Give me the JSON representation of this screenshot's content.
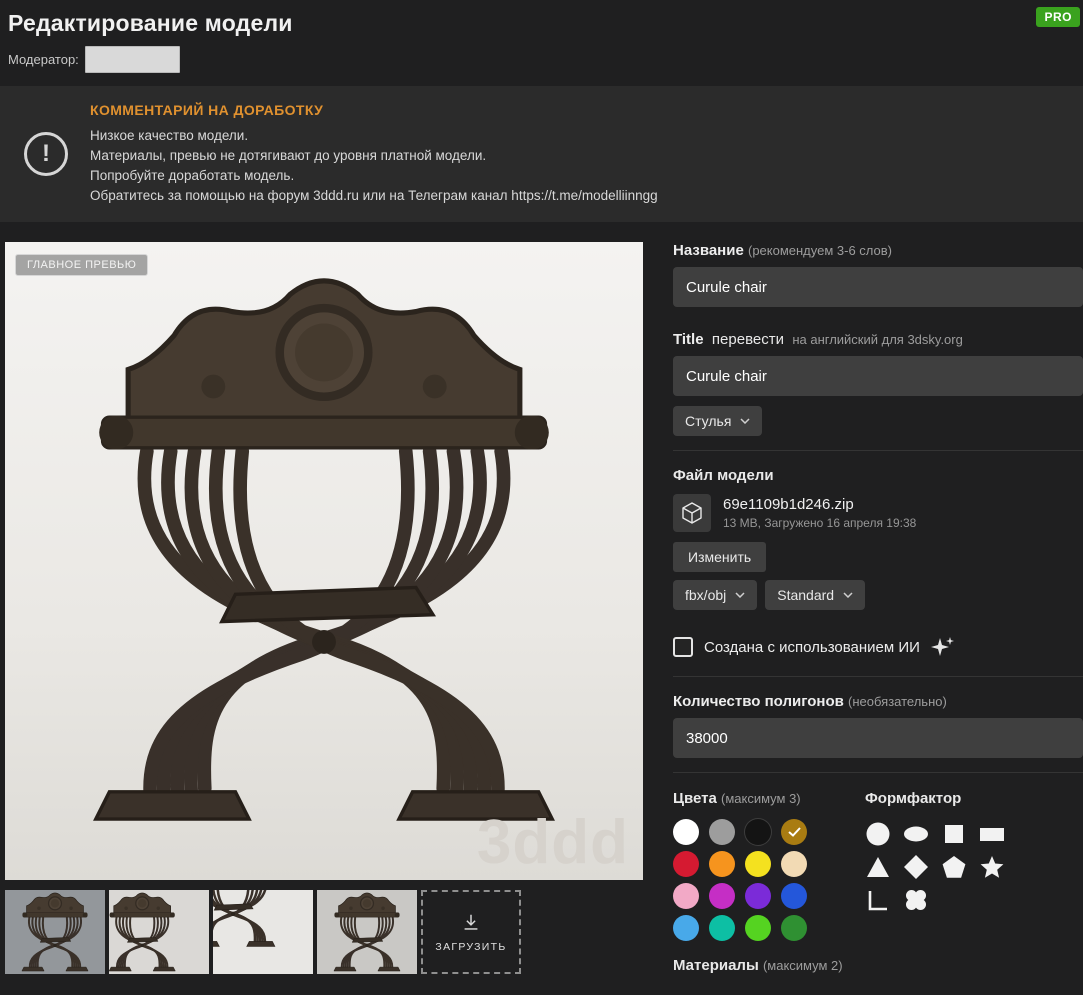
{
  "theme": {
    "pro_green": "#3aa21e",
    "accent_orange": "#e0912f",
    "panel_bg": "#2b2b2b",
    "input_bg": "#3f3f3f"
  },
  "header": {
    "title": "Редактирование модели",
    "pro_badge": "PRO",
    "moderator_label": "Модератор:",
    "moderator_value": ""
  },
  "warning": {
    "heading": "КОММЕНТАРИЙ НА ДОРАБОТКУ",
    "lines": [
      "Низкое качество модели.",
      "Материалы, превью не дотягивают до уровня платной модели.",
      "Попробуйте доработать модель.",
      "Обратитесь за помощью на форум 3ddd.ru или на Телеграм канал https://t.me/modelliinngg"
    ]
  },
  "preview": {
    "main_badge": "ГЛАВНОЕ ПРЕВЬЮ",
    "watermark": "3ddd",
    "upload_button": "ЗАГРУЗИТЬ"
  },
  "fields": {
    "name_label": "Название",
    "name_hint": "(рекомендуем 3-6 слов)",
    "name_value": "Curule chair",
    "title_label": "Title",
    "title_translate_link": "перевести",
    "title_hint": "на английский для 3dsky.org",
    "title_value": "Curule chair",
    "category_value": "Стулья",
    "polygons_label": "Количество полигонов",
    "polygons_hint": "(необязательно)",
    "polygons_value": "38000"
  },
  "file": {
    "section_title": "Файл модели",
    "filename": "69e1109b1d246.zip",
    "meta": "13 МВ, Загружено 16 апреля 19:38",
    "change_button": "Изменить",
    "format_value": "fbx/obj",
    "renderer_value": "Standard"
  },
  "ai": {
    "label": "Создана с использованием ИИ"
  },
  "colors": {
    "label": "Цвета",
    "hint": "(максимум 3)",
    "selected_index": 3,
    "swatches": [
      {
        "name": "white",
        "hex": "#ffffff"
      },
      {
        "name": "gray",
        "hex": "#9d9d9d"
      },
      {
        "name": "black",
        "hex": "#141414"
      },
      {
        "name": "ochre",
        "hex": "#a97c12"
      },
      {
        "name": "red",
        "hex": "#d51a31"
      },
      {
        "name": "orange",
        "hex": "#f6941e"
      },
      {
        "name": "yellow",
        "hex": "#f4e11f"
      },
      {
        "name": "beige",
        "hex": "#f2dab4"
      },
      {
        "name": "pink",
        "hex": "#f2a9c6"
      },
      {
        "name": "magenta",
        "hex": "#c52ec5"
      },
      {
        "name": "violet",
        "hex": "#7b2bd8"
      },
      {
        "name": "blue",
        "hex": "#2457da"
      },
      {
        "name": "light-blue",
        "hex": "#48a9e9"
      },
      {
        "name": "teal",
        "hex": "#0dbfa4"
      },
      {
        "name": "green",
        "hex": "#55d321"
      },
      {
        "name": "dark-green",
        "hex": "#2f9032"
      }
    ]
  },
  "formfactor": {
    "label": "Формфактор",
    "shapes": [
      "circle",
      "ellipse",
      "square",
      "rectangle",
      "triangle",
      "diamond",
      "pentagon",
      "star",
      "l-shape",
      "clover"
    ]
  },
  "materials": {
    "label": "Материалы",
    "hint": "(максимум 2)"
  }
}
